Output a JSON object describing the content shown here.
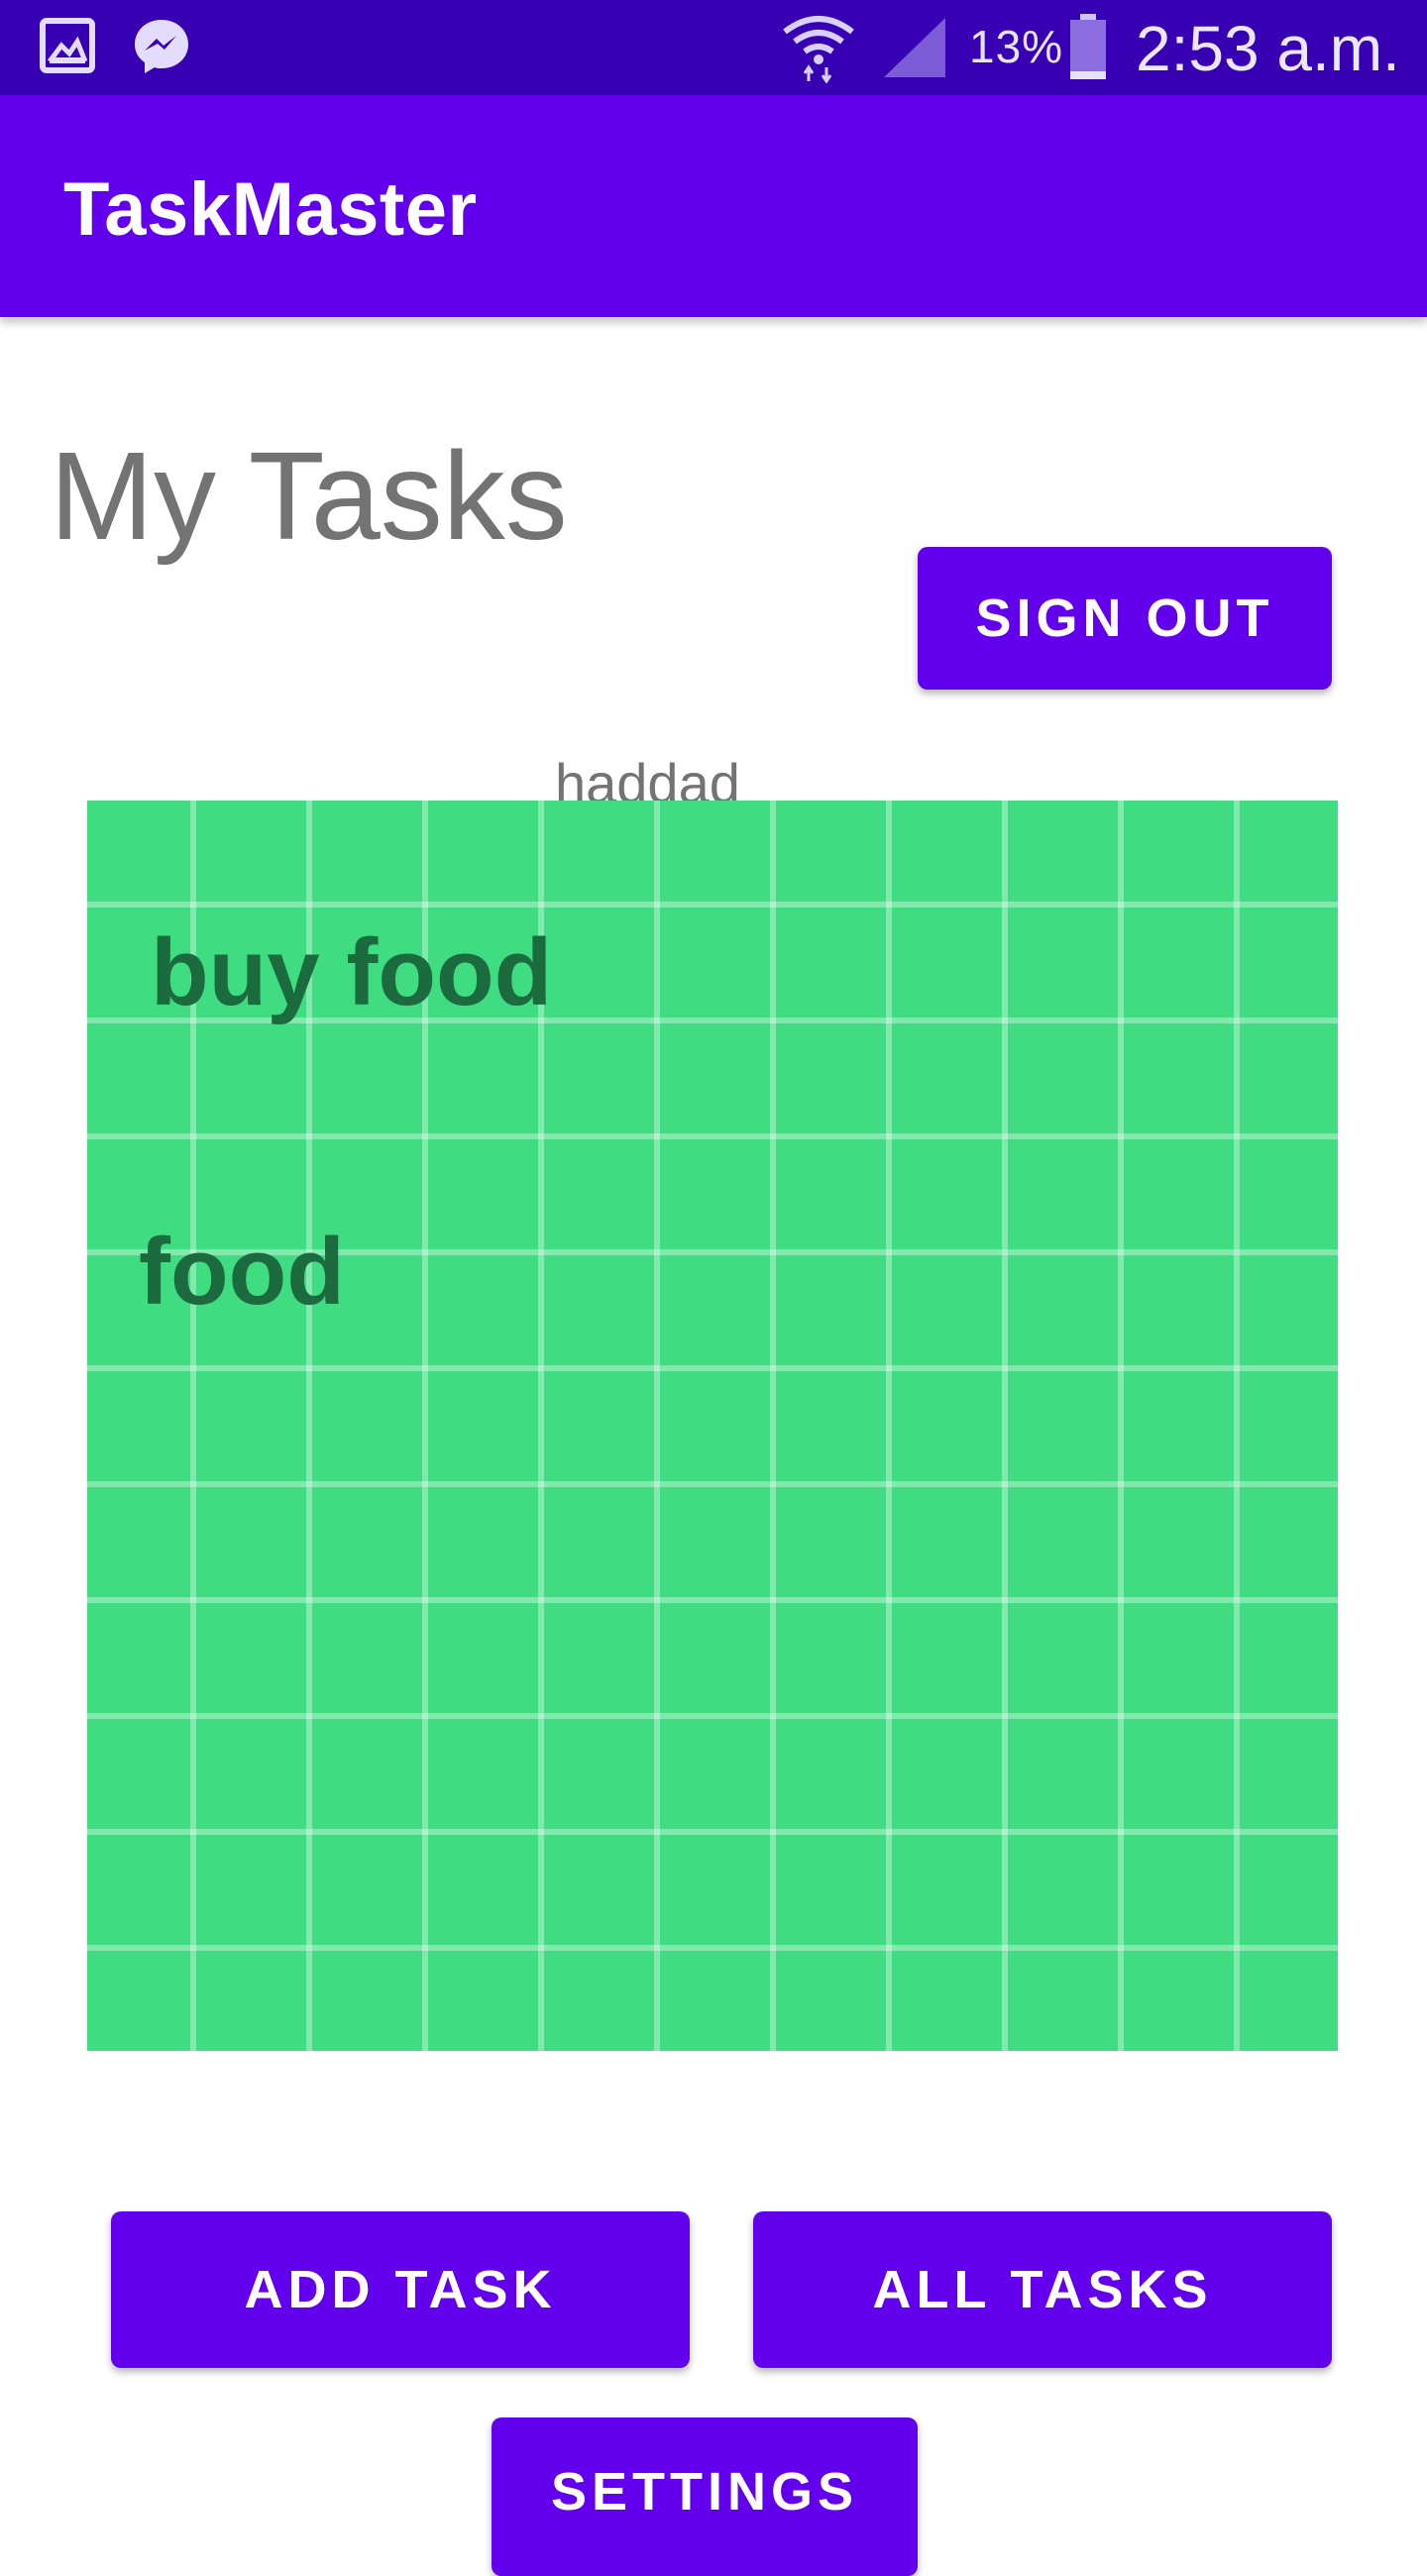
{
  "status_bar": {
    "battery_percent": "13%",
    "time": "2:53 a.m.",
    "icons": [
      "gallery-icon",
      "messenger-icon",
      "wifi-icon",
      "signal-icon",
      "battery-icon"
    ]
  },
  "app_bar": {
    "title": "TaskMaster"
  },
  "main": {
    "page_title": "My Tasks",
    "sign_out_label": "Sign out",
    "username": "haddad",
    "tasks": [
      {
        "title": "buy food"
      },
      {
        "title": "food"
      }
    ],
    "add_task_label": "Add task",
    "all_tasks_label": "All tasks",
    "settings_label": "Settings"
  },
  "colors": {
    "status_bar": "#3700b3",
    "primary": "#6200ee",
    "task_panel": "#40dc82",
    "task_text": "#1c6b3f",
    "muted_text": "#737373"
  }
}
